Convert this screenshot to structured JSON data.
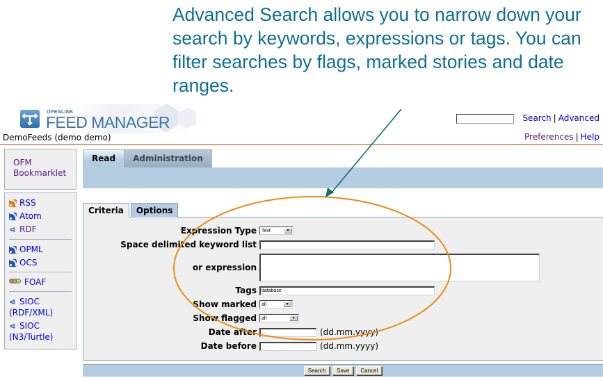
{
  "callout": {
    "text": "Advanced Search allows you to narrow down your search by keywords, expressions or tags. You can filter searches by flags, marked stories and date ranges.",
    "color": "#0e6f95"
  },
  "header": {
    "logo_small": "OPENLINK",
    "logo_big": "FEED MANAGER",
    "app_title": "DemoFeeds (demo demo)",
    "search_input_value": "",
    "search_link": "Search",
    "advanced_link": "Advanced",
    "preferences_link": "Preferences",
    "help_link": "Help",
    "separator": "|"
  },
  "sidebar": {
    "bookmarklet": [
      "OFM",
      "Bookmarklet"
    ],
    "feeds": [
      {
        "label": "RSS",
        "icon": "rss-icon"
      },
      {
        "label": "Atom",
        "icon": "atom-feed-icon"
      },
      {
        "label": "RDF",
        "icon": "rdf-icon"
      },
      {
        "label": "OPML",
        "icon": "opml-feed-icon"
      },
      {
        "label": "OCS",
        "icon": "ocs-feed-icon"
      },
      {
        "label": "FOAF",
        "icon": "foaf-icon"
      },
      {
        "label_line1": "SIOC",
        "label_line2": "(RDF/XML)",
        "icon": "sioc-icon"
      },
      {
        "label_line1": "SIOC",
        "label_line2": "(N3/Turtle)",
        "icon": "sioc-icon"
      }
    ]
  },
  "main_tabs": [
    {
      "label": "Read",
      "active": true
    },
    {
      "label": "Administration",
      "active": false
    }
  ],
  "sub_tabs": [
    {
      "label": "Criteria",
      "active": true
    },
    {
      "label": "Options",
      "active": false
    }
  ],
  "form": {
    "expression_type": {
      "label": "Expression Type",
      "value": "Text"
    },
    "keywords": {
      "label": "Space delimited keyword list",
      "value": ""
    },
    "expression": {
      "label": "or expression",
      "value": ""
    },
    "tags": {
      "label": "Tags",
      "value": "database"
    },
    "show_marked": {
      "label": "Show marked",
      "value": "all"
    },
    "show_flagged": {
      "label": "Show flagged",
      "value": "all"
    },
    "date_after": {
      "label": "Date after",
      "value": "",
      "hint": "(dd.mm.yyyy)"
    },
    "date_before": {
      "label": "Date before",
      "value": "",
      "hint": "(dd.mm.yyyy)"
    }
  },
  "footer_buttons": {
    "search": "Search",
    "save": "Save",
    "cancel": "Cancel"
  },
  "annotation_colors": {
    "arrow": "#0f6e73",
    "ellipse": "#f08a12"
  }
}
